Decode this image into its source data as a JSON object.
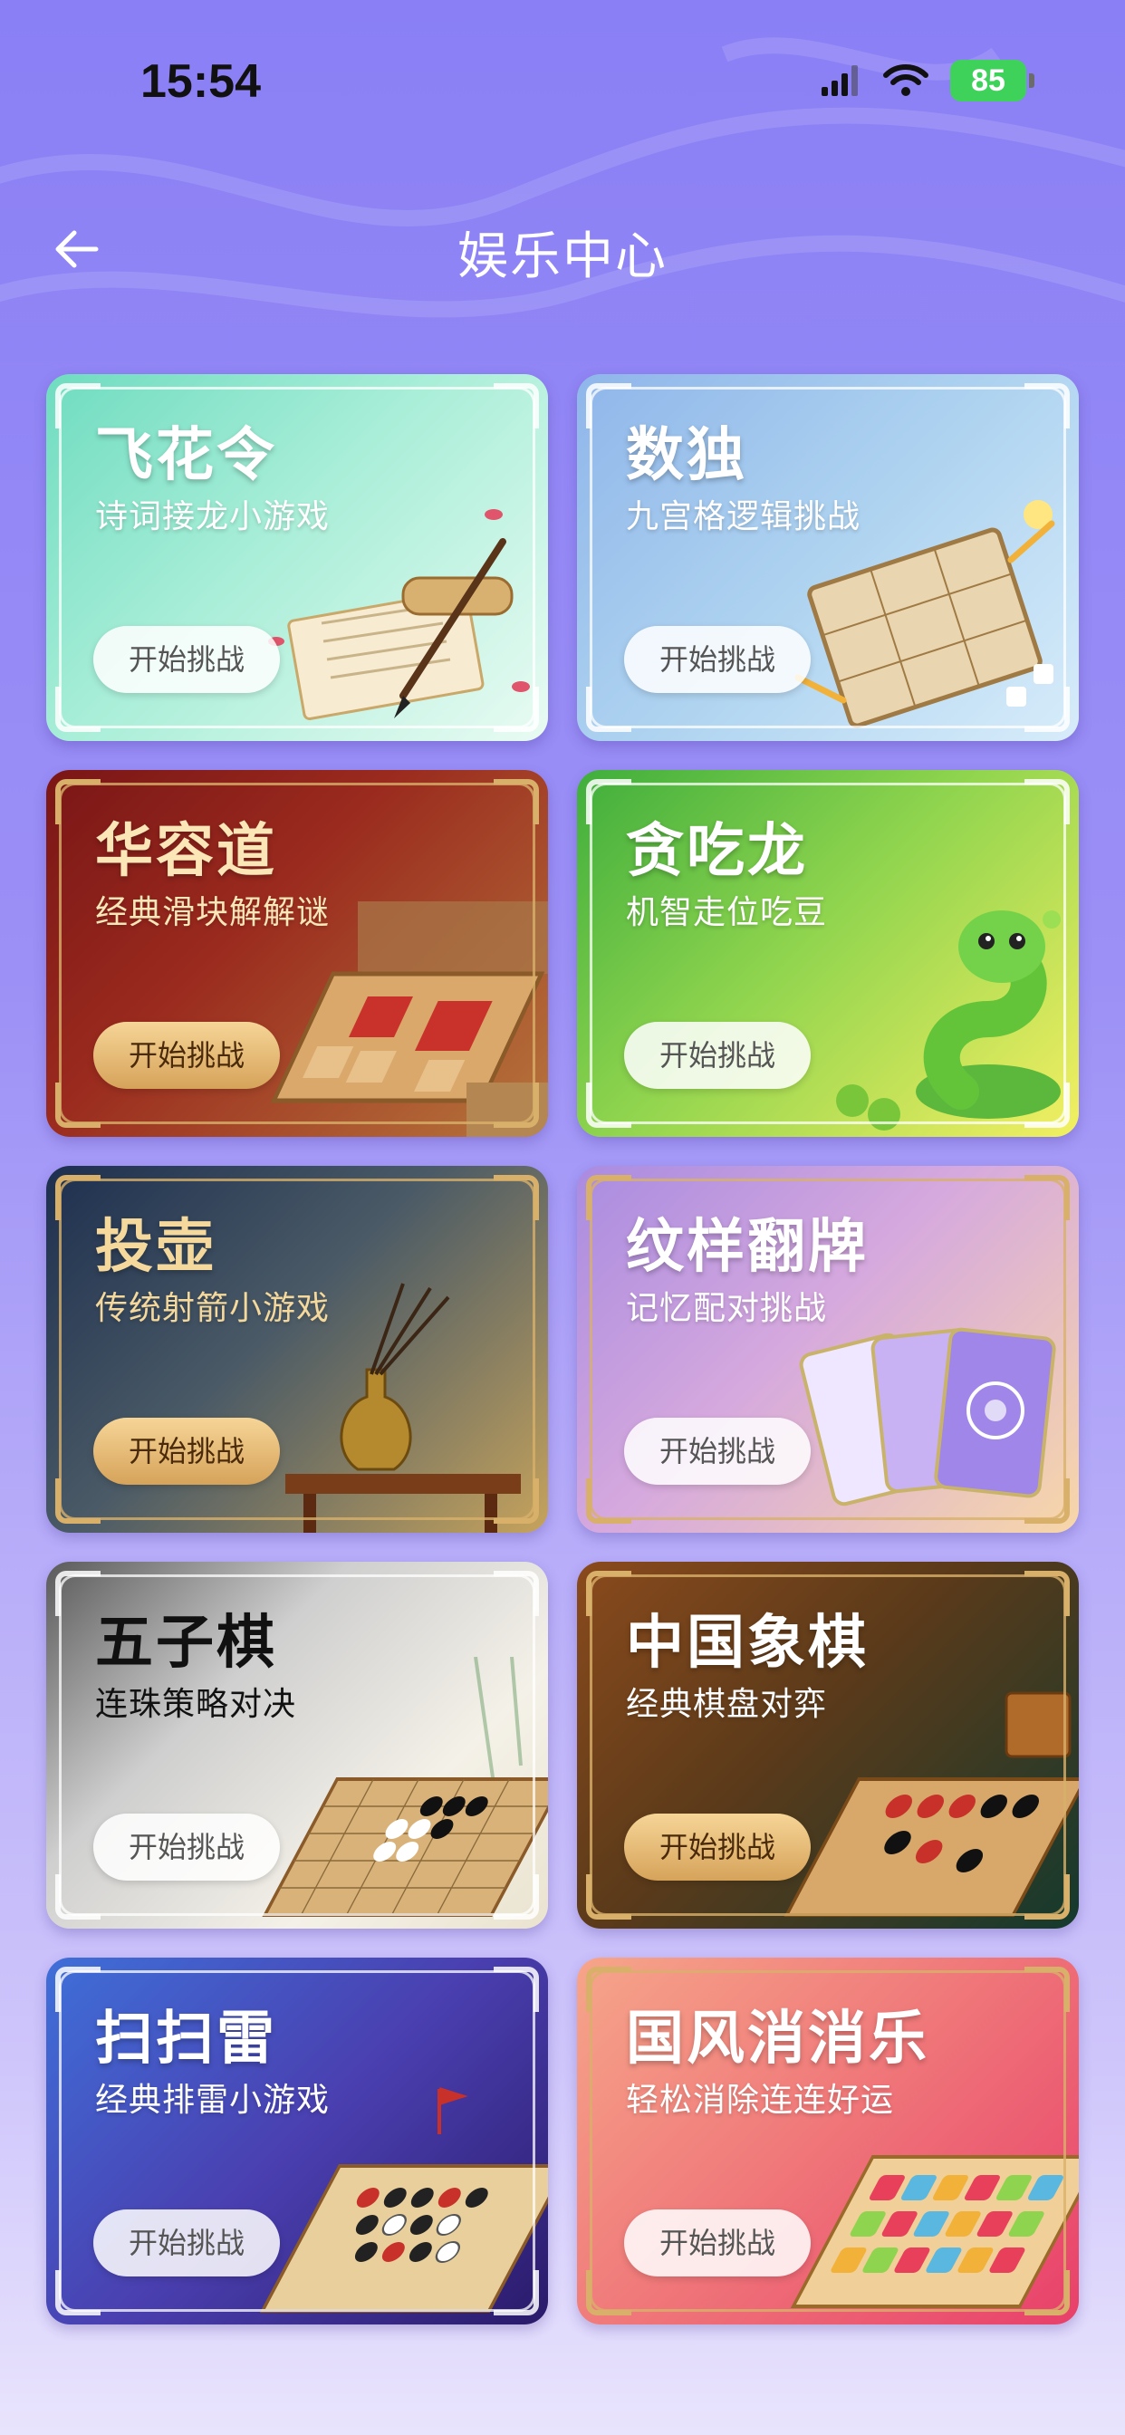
{
  "status_bar": {
    "time": "15:54",
    "battery": "85",
    "icons": [
      "signal-icon",
      "wifi-icon",
      "battery-icon"
    ]
  },
  "header": {
    "back_icon": "back-arrow-icon",
    "title": "娱乐中心"
  },
  "cards": [
    {
      "id": "feihualing",
      "title": "飞花令",
      "subtitle": "诗词接龙小游戏",
      "button": "开始挑战",
      "illustration": "scroll-and-brush"
    },
    {
      "id": "shudu",
      "title": "数独",
      "subtitle": "九宫格逻辑挑战",
      "button": "开始挑战",
      "illustration": "sudoku-board"
    },
    {
      "id": "huarongdao",
      "title": "华容道",
      "subtitle": "经典滑块解解谜",
      "button": "开始挑战",
      "illustration": "sliding-puzzle-board"
    },
    {
      "id": "tanchilong",
      "title": "贪吃龙",
      "subtitle": "机智走位吃豆",
      "button": "开始挑战",
      "illustration": "green-snake"
    },
    {
      "id": "touhu",
      "title": "投壶",
      "subtitle": "传统射箭小游戏",
      "button": "开始挑战",
      "illustration": "pot-with-arrows"
    },
    {
      "id": "wenyangfanpai",
      "title": "纹样翻牌",
      "subtitle": "记忆配对挑战",
      "button": "开始挑战",
      "illustration": "pattern-cards"
    },
    {
      "id": "wuziqi",
      "title": "五子棋",
      "subtitle": "连珠策略对决",
      "button": "开始挑战",
      "illustration": "gomoku-board"
    },
    {
      "id": "xiangqi",
      "title": "中国象棋",
      "subtitle": "经典棋盘对弈",
      "button": "开始挑战",
      "illustration": "xiangqi-board"
    },
    {
      "id": "saosaolei",
      "title": "扫扫雷",
      "subtitle": "经典排雷小游戏",
      "button": "开始挑战",
      "illustration": "minesweeper-board"
    },
    {
      "id": "guofengxiaoxiaole",
      "title": "国风消消乐",
      "subtitle": "轻松消除连连好运",
      "button": "开始挑战",
      "illustration": "match-tiles-board"
    }
  ],
  "colors": {
    "background_top": "#8a7ff5",
    "background_bottom": "#e9e4fd",
    "battery_green": "#3fd25a"
  }
}
